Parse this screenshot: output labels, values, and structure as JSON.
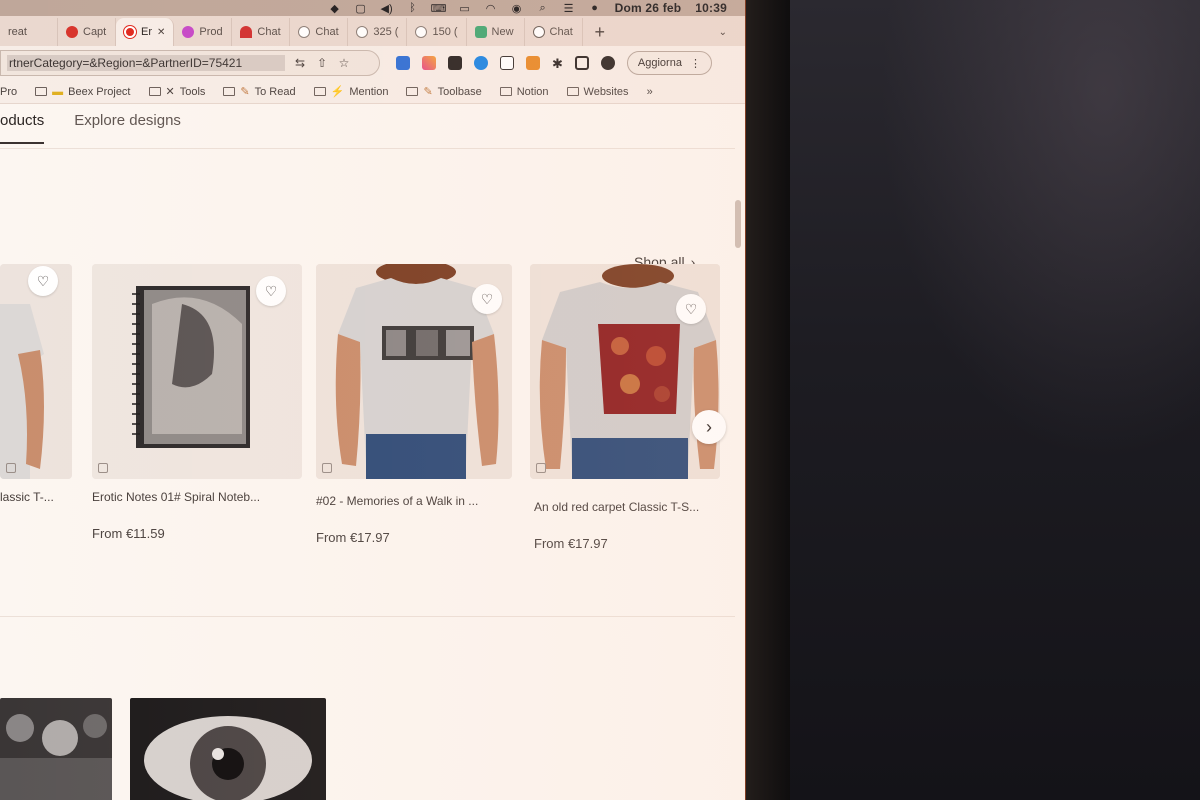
{
  "system_bar": {
    "date": "Dom 26 feb",
    "time": "10:39",
    "icons": [
      "apple-icon",
      "dropbox-icon",
      "app-icon",
      "volume-icon",
      "bluetooth-icon",
      "keyboard-icon",
      "battery-icon",
      "wifi-icon",
      "user-icon",
      "search-icon",
      "control-center-icon",
      "siri-icon"
    ]
  },
  "tabs": [
    {
      "label": "reat",
      "favicon_color": "#ffffff",
      "active": false
    },
    {
      "label": "Capt",
      "favicon_color": "#d8342c",
      "active": false
    },
    {
      "label": "Er",
      "favicon_color": "#e0281e",
      "active": true
    },
    {
      "label": "Prod",
      "favicon_color": "#c648c8",
      "active": false
    },
    {
      "label": "Chat",
      "favicon_color": "#d13030",
      "active": false
    },
    {
      "label": "Chat",
      "favicon_color": "#ffffff",
      "active": false
    },
    {
      "label": "325 (",
      "favicon_color": "#ffffff",
      "active": false
    },
    {
      "label": "150 (",
      "favicon_color": "#ffffff",
      "active": false
    },
    {
      "label": "New",
      "favicon_color": "#43a874",
      "active": false
    },
    {
      "label": "Chat",
      "favicon_color": "#ffffff",
      "active": false
    }
  ],
  "address_bar": {
    "url": "rtnerCategory=&Region=&PartnerID=75421"
  },
  "toolbar": {
    "update_label": "Aggiorna"
  },
  "bookmarks": [
    {
      "label": "Pro",
      "type": "link"
    },
    {
      "label": "Beex Project",
      "type": "folder"
    },
    {
      "label": "Tools",
      "type": "folder"
    },
    {
      "label": "To Read",
      "type": "folder"
    },
    {
      "label": "Mention",
      "type": "folder"
    },
    {
      "label": "Toolbase",
      "type": "folder"
    },
    {
      "label": "Notion",
      "type": "folder"
    },
    {
      "label": "Websites",
      "type": "folder"
    }
  ],
  "subnav": {
    "products_label": "oducts",
    "explore_label": "Explore designs"
  },
  "section": {
    "shop_all": "Shop all"
  },
  "products": [
    {
      "title": "lassic T-...",
      "price": ""
    },
    {
      "title": "Erotic Notes 01# Spiral Noteb...",
      "price": "From €11.59"
    },
    {
      "title": "#02 - Memories of a Walk in ...",
      "price": "From €17.97"
    },
    {
      "title": "An old red carpet Classic T-S...",
      "price": "From €17.97"
    }
  ],
  "colors": {
    "accent_red": "#e0281e",
    "laptop_edge": "#d35a2b"
  }
}
